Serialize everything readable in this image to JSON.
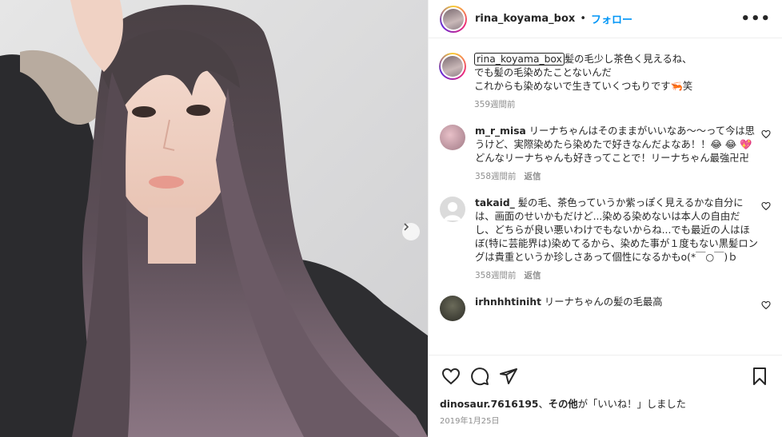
{
  "post": {
    "username": "rina_koyama_box",
    "dot": "•",
    "follow_label": "フォロー",
    "more_label": "•••"
  },
  "caption": {
    "username": "rina_koyama_box",
    "lines": [
      "髪の毛少し茶色く見えるね、",
      "でも髪の毛染めたことないんだ",
      "これからも染めないで生きていくつもりです🦐笑"
    ],
    "time": "359週間前"
  },
  "comments": [
    {
      "username": "m_r_misa",
      "text": "リーナちゃんはそのままがいいなあ〜〜って今は思うけど、実際染めたら染めたで好きなんだよなあ！！😂 😂 💖どんなリーナちゃんも好きってことで！リーナちゃん最強卍卍",
      "time": "358週間前",
      "reply": "返信"
    },
    {
      "username": "takaid_",
      "text": "髪の毛、茶色っていうか紫っぽく見えるかな自分には、画面のせいかもだけど...染める染めないは本人の自由だし、どちらが良い悪いわけでもないからね...でも最近の人はほぼ(特に芸能界は)染めてるから、染めた事が１度もない黒髪ロングは貴重というか珍しさあって個性になるかもo(*￣○￣)ｂ",
      "time": "358週間前",
      "reply": "返信"
    },
    {
      "username": "irhnhhtiniht",
      "text": "リーナちゃんの髪の毛最高",
      "time": "",
      "reply": ""
    }
  ],
  "likes": {
    "user": "dinosaur.7616195",
    "sep": "、",
    "others": "その他",
    "suffix": "が「いいね！」しました"
  },
  "date": "2019年1月25日",
  "icons": [
    "heart-icon",
    "comment-icon",
    "share-icon",
    "save-icon",
    "chevron-right-icon",
    "more-icon"
  ],
  "colors": {
    "accent": "#0095f6",
    "muted": "#8e8e8e"
  }
}
